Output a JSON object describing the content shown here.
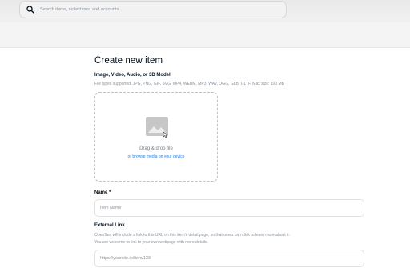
{
  "search": {
    "placeholder": "Search items, collections, and accounts",
    "icon": "search-icon"
  },
  "form": {
    "title": "Create new item",
    "media": {
      "label": "Image, Video, Audio, or 3D Model",
      "hint": "File types supported: JPG, PNG, GIF, SVG, MP4, WEBM, MP3, WAV, OGG, GLB, GLTF. Max size: 100 MB",
      "drop_title": "Drag & drop file",
      "drop_prefix": "or ",
      "drop_link": "browse media on your device"
    },
    "name": {
      "label": "Name *",
      "placeholder": "Item Name"
    },
    "external_link": {
      "label": "External Link",
      "hint_line1": "OpenSea will include a link to this URL on this item's detail page, so that users can click to learn more about it.",
      "hint_line2": "You are welcome to link to your own webpage with more details.",
      "placeholder": "https://yoursite.io/item/123"
    }
  },
  "colors": {
    "link": "#2081e2",
    "text": "#04111d",
    "muted": "#8a939b"
  }
}
